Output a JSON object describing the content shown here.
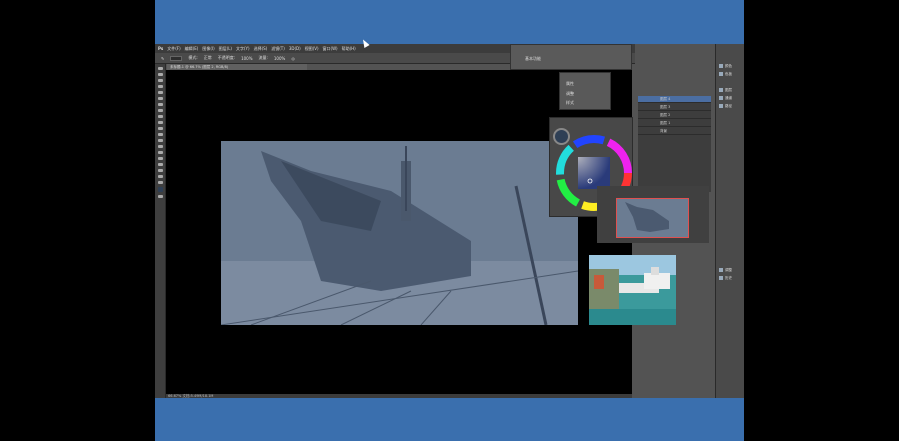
{
  "app": {
    "logo": "Ps",
    "menu": [
      "文件(F)",
      "编辑(E)",
      "图像(I)",
      "图层(L)",
      "文字(Y)",
      "选择(S)",
      "滤镜(T)",
      "3D(D)",
      "视图(V)",
      "窗口(W)",
      "帮助(H)"
    ]
  },
  "options": {
    "mode_label": "模式:",
    "mode_value": "正常",
    "opacity_label": "不透明度:",
    "opacity_value": "100%",
    "flow_label": "流量:",
    "flow_value": "100%"
  },
  "document": {
    "tab_title": "未标题-1 @ 66.7% (图层 2, RGB/8)",
    "status": "66.67%    文档:5.49M/18.1M"
  },
  "float_panel": {
    "label": "基本功能"
  },
  "small_panel": {
    "items": [
      "属性",
      "调整",
      "样式"
    ]
  },
  "layers": {
    "rows": [
      {
        "name": "图层 4",
        "selected": true
      },
      {
        "name": "图层 3",
        "selected": false
      },
      {
        "name": "图层 2",
        "selected": false
      },
      {
        "name": "图层 1",
        "selected": false
      },
      {
        "name": "背景",
        "selected": false
      }
    ]
  },
  "right_dock": {
    "items": [
      "颜色",
      "色板",
      "图层",
      "通道",
      "路径",
      "调整",
      "历史"
    ]
  },
  "colors": {
    "desktop": "#3a6fae",
    "foreground": "#2e3f55",
    "layer_selected": "#4b6ea2"
  }
}
